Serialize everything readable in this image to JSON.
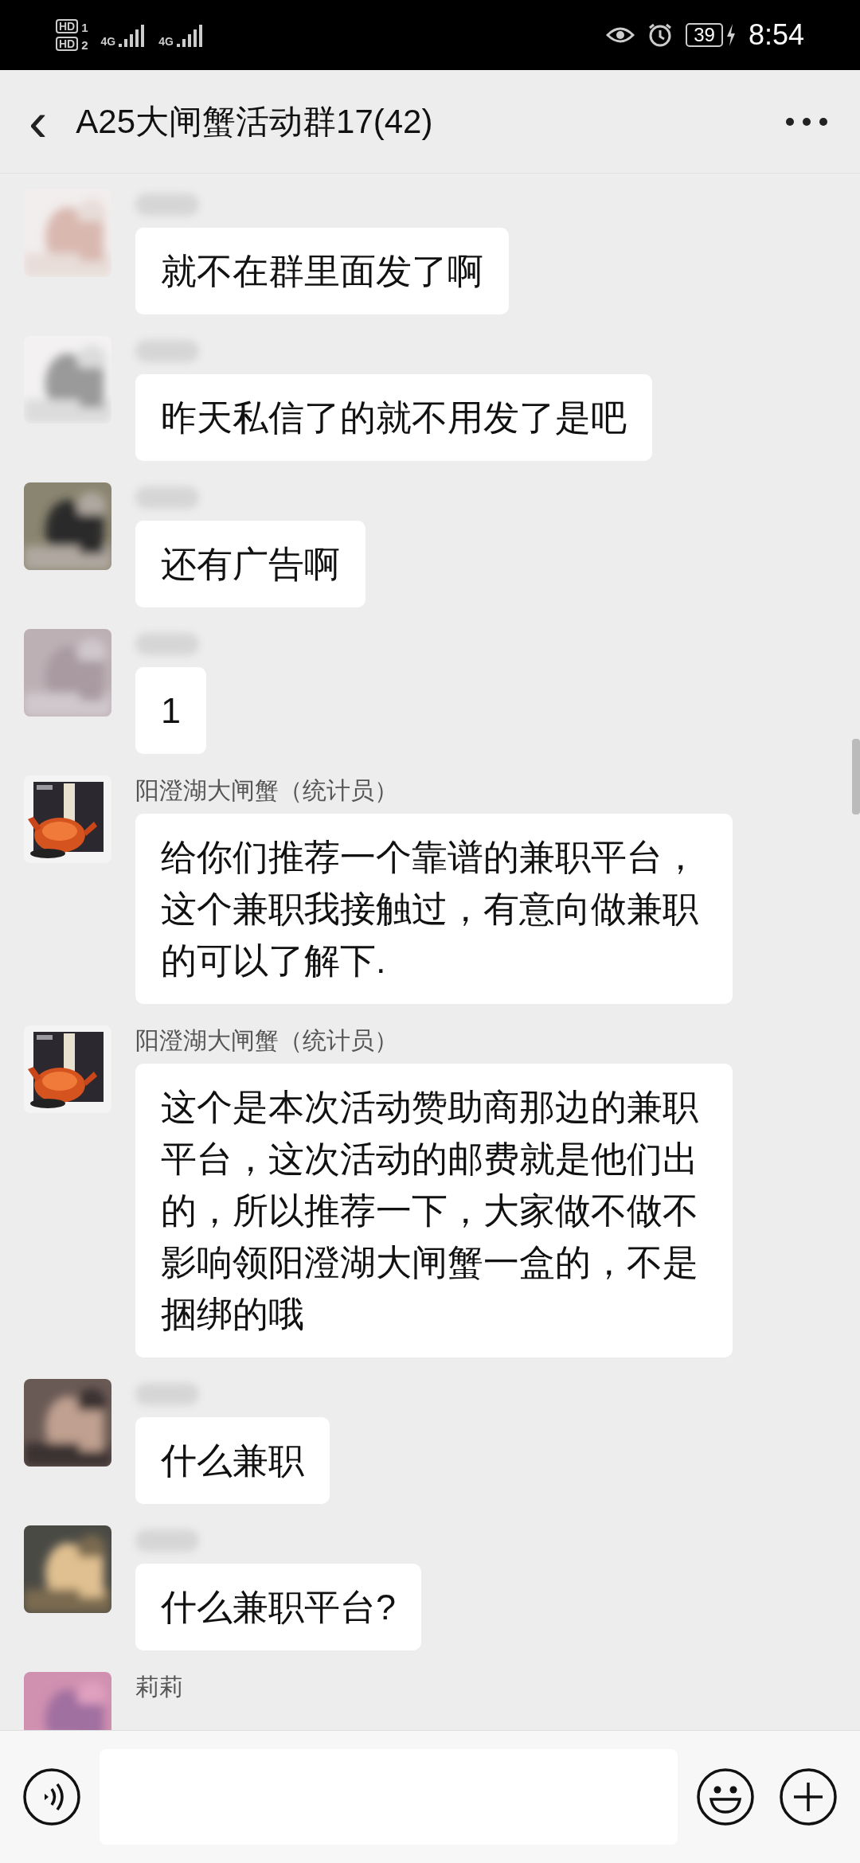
{
  "status_bar": {
    "sims": [
      {
        "label": "HD",
        "slot": "1",
        "network": "4G"
      },
      {
        "label": "HD",
        "slot": "2",
        "network": "4G"
      }
    ],
    "battery": "39",
    "time": "8:54"
  },
  "header": {
    "back": "‹",
    "title": "A25大闸蟹活动群17(42)"
  },
  "messages": [
    {
      "text": "就不在群里面发了啊"
    },
    {
      "text": "昨天私信了的就不用发了是吧"
    },
    {
      "text": "还有广告啊"
    },
    {
      "text": "1"
    },
    {
      "sender": "阳澄湖大闸蟹（统计员）",
      "text": "给你们推荐一个靠谱的兼职平台，这个兼职我接触过，有意向做兼职的可以了解下."
    },
    {
      "sender": "阳澄湖大闸蟹（统计员）",
      "text": "这个是本次活动赞助商那边的兼职平台，这次活动的邮费就是他们出的，所以推荐一下，大家做不做不影响领阳澄湖大闸蟹一盒的，不是捆绑的哦"
    },
    {
      "text": "什么兼职"
    },
    {
      "text": "什么兼职平台?"
    },
    {
      "sender": "莉莉"
    }
  ]
}
